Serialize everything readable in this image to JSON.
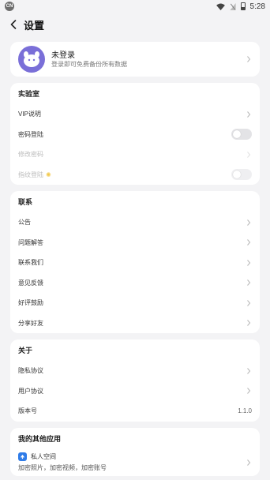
{
  "status_bar": {
    "carrier_badge": "CN",
    "time": "5:28",
    "icons": [
      "wifi-icon",
      "no-sim-icon",
      "battery-icon"
    ]
  },
  "header": {
    "title": "设置",
    "back_icon": "chevron-left-icon"
  },
  "profile": {
    "name": "未登录",
    "subtitle": "登录即可免费备份所有数据",
    "avatar_color": "#7a6fd8"
  },
  "lab": {
    "title": "实验室",
    "vip": "VIP说明",
    "password_login": "密码登陆",
    "password_login_on": false,
    "change_password": "修改密码",
    "fingerprint_login": "指纹登陆",
    "fingerprint_login_on": false
  },
  "contact": {
    "title": "联系",
    "items": [
      "公告",
      "问题解答",
      "联系我们",
      "意见反馈",
      "好评鼓励",
      "分享好友"
    ]
  },
  "about": {
    "title": "关于",
    "privacy": "隐私协议",
    "user_agreement": "用户协议",
    "version_label": "版本号",
    "version_value": "1.1.0"
  },
  "other_apps": {
    "title": "我的其他应用",
    "app_name": "私人空间",
    "app_desc": "加密照片，加密视频，加密账号",
    "app_icon_color": "#2f7ce8"
  }
}
